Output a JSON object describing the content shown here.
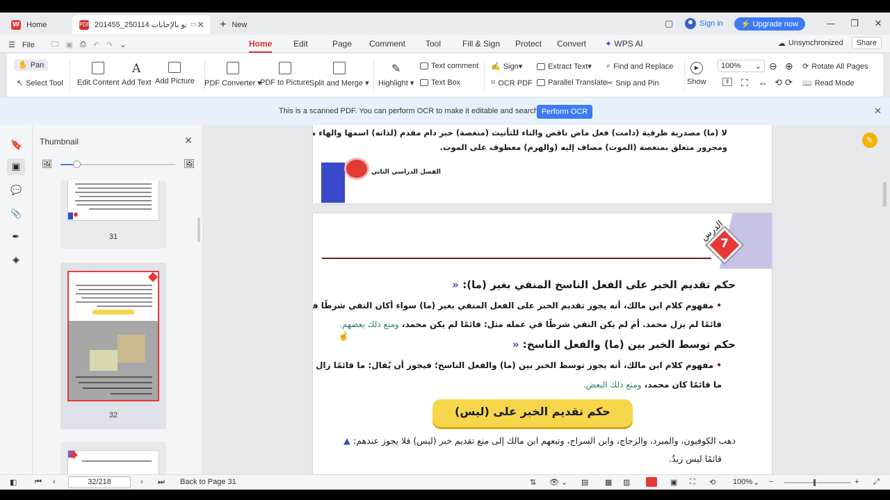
{
  "tabs": {
    "home": "Home",
    "document": "201455_250114 نحو بالإجابات",
    "new": "New"
  },
  "account": {
    "signin": "Sign in",
    "upgrade": "Upgrade now"
  },
  "menu": {
    "file": "File",
    "tabs": [
      "Home",
      "Edit",
      "Page",
      "Comment",
      "Tool",
      "Fill & Sign",
      "Protect",
      "Convert",
      "WPS AI"
    ],
    "active_tab": "Home",
    "unsync": "Unsynchronized",
    "share": "Share"
  },
  "toolbar": {
    "pan": "Pan",
    "select_tool": "Select Tool",
    "edit_content": "Edit Content",
    "add_text": "Add Text",
    "add_picture": "Add Picture",
    "pdf_converter": "PDF Converter",
    "pdf_to_picture": "PDF to Picture",
    "split_merge": "Split and Merge",
    "highlight": "Highlight",
    "text_comment": "Text comment",
    "text_box": "Text Box",
    "sign": "Sign",
    "ocr_pdf": "OCR PDF",
    "extract_text": "Extract Text",
    "parallel_translate": "Parallel Translate",
    "find_replace": "Find and Replace",
    "snip_pin": "Snip and Pin",
    "show": "Show",
    "zoom": "100%",
    "rotate_all": "Rotate All Pages",
    "read_mode": "Read Mode"
  },
  "infobar": {
    "text": "This is a scanned PDF. You can perform OCR to make it editable and searchable.",
    "button": "Perform OCR"
  },
  "thumbnail": {
    "title": "Thumbnail",
    "pages": [
      "31",
      "32"
    ]
  },
  "document": {
    "prev_line1": "لا (ما) مصدرية ظرفية (دامت) فعل ماض ناقص والتاء للتأنيث (منغصة) خبر دام مقدم (لذاته) اسمها والهاء مضاف إليه (بادكار) جار",
    "prev_line2": "ومجرور متعلق بمنغصة (الموت) مضاف إليه (والهرم) معطوف على الموت.",
    "prev_footer": "الفصل الدراسي الثاني",
    "lesson_word": "الدرس",
    "lesson_num": "7",
    "h1": "حكم تقديم الخبر على الفعل الناسخ المنفي بغير (ما):",
    "p1a": "مفهوم كلام ابن مالك، أنه يجوز تقديم الخبر على الفعل المنفي بغير (ما) سواء أكان النفي شرطًا في عمله مثل:",
    "p1b": "قائمًا لم يزل محمد. أم لم يكن النفي شرطًا في عمله مثل: قائمًا لم يكن محمد،",
    "p1b_green": "ومنع ذلك بعضهم.",
    "h2": "حكم توسط الخبر بين (ما) والفعل الناسخ:",
    "p2a": "مفهوم كلام ابن مالك، أنه يجوز توسط الخبر بين (ما) والفعل الناسخ؛ فيجوز أن يُقال: ما قائمًا زال زيد، ويجوز:",
    "p2b": "ما قائمًا كان محمد،",
    "p2b_green": "ومنع ذلك البعض.",
    "banner": "حكم تقديم الخبر على (ليس)",
    "p3a": "ذهب الكوفيون، والمبرد، والزجاج، وابن السراج، وتبعهم ابن مالك إلى منع تقديم خبر (ليس) فلا يجوز عندهم:",
    "p3b": "قائمًا ليس زيدٌ."
  },
  "status": {
    "page_input": "32/218",
    "back": "Back to Page 31",
    "zoom": "100%"
  },
  "colors": {
    "accent": "#d32f2f",
    "primary": "#3d7bf2",
    "banner": "#f6d64a"
  }
}
